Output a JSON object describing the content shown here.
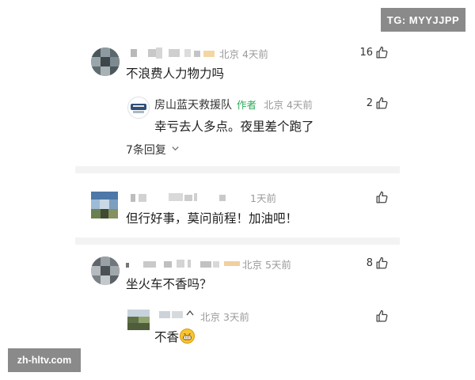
{
  "watermarks": {
    "top_right": "TG: MYYJJPP",
    "bottom_left": "zh-hltv.com"
  },
  "comments": [
    {
      "meta": "北京 4天前",
      "text": "不浪费人力物力吗",
      "likes": "16",
      "reply": {
        "name": "房山蓝天救援队",
        "author_tag": "作者",
        "meta": "北京 4天前",
        "text": "幸亏去人多点。夜里差个跑了",
        "likes": "2"
      },
      "more_replies": "7条回复",
      "more_replies_icon": "chevron-down-icon"
    },
    {
      "meta": "1天前",
      "text": "但行好事，莫问前程！加油吧！",
      "likes": ""
    },
    {
      "meta": "北京 5天前",
      "text": "坐火车不香吗？",
      "likes": "8",
      "reply": {
        "meta": "北京 3天前",
        "text": "不香",
        "emoji": "grinning-face-emoji",
        "likes": ""
      }
    }
  ],
  "icons": {
    "like": "thumbs-up-icon"
  },
  "colors": {
    "author_tag": "#2eaa5a",
    "meta_gray": "#9a9a9a",
    "separator": "#f3f3f3",
    "watermark_bg": "#8a8a8a"
  }
}
